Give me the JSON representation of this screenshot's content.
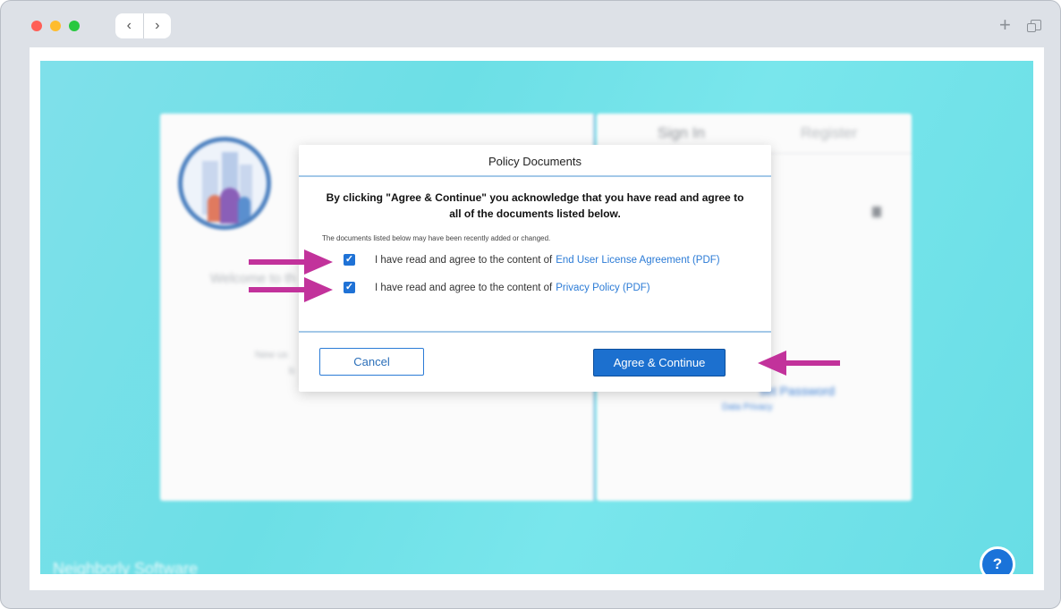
{
  "browser": {
    "back_glyph": "‹",
    "forward_glyph": "›",
    "new_tab_glyph": "+"
  },
  "background": {
    "tabs": {
      "sign_in": "Sign In",
      "register": "Register"
    },
    "welcome": "Welcome to th",
    "new_user": "New us",
    "new_user_cont": "b",
    "reset": "set Password",
    "data_privacy": "Data Privacy",
    "brand": "Neighborly Software",
    "help": "?"
  },
  "modal": {
    "title": "Policy Documents",
    "heading": "By clicking \"Agree & Continue\" you acknowledge that you have read and agree to all of the documents listed below.",
    "notice": "The documents listed below may have been recently added or changed.",
    "documents": [
      {
        "prefix": "I have read and agree to the content of",
        "link": "End User License Agreement (PDF)",
        "checked": true
      },
      {
        "prefix": "I have read and agree to the content of",
        "link": "Privacy Policy (PDF)",
        "checked": true
      }
    ],
    "cancel_label": "Cancel",
    "agree_label": "Agree & Continue"
  },
  "colors": {
    "accent": "#1c70cf",
    "annotation_arrow": "#c2329b",
    "background": "#6cdfe6"
  },
  "icons": [
    "back-icon",
    "forward-icon",
    "plus-icon",
    "tabs-icon",
    "checkmark-icon",
    "help-icon",
    "arrow-annotation-icon"
  ]
}
